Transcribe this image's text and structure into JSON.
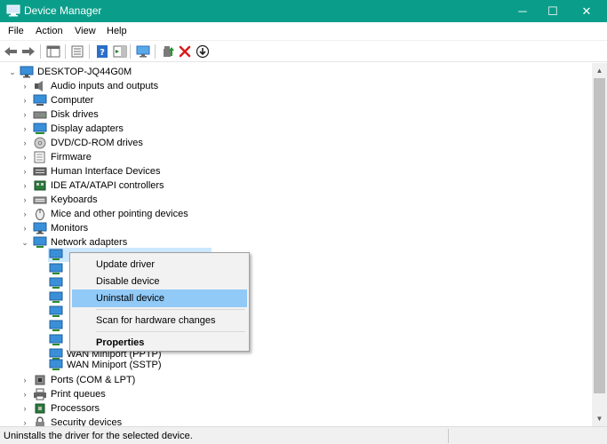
{
  "window": {
    "title": "Device Manager",
    "min_glyph": "─",
    "max_glyph": "☐",
    "close_glyph": "✕",
    "accent": "#0a9e8a"
  },
  "menu": [
    "File",
    "Action",
    "View",
    "Help"
  ],
  "tree": {
    "root": "DESKTOP-JQ44G0M",
    "categories": [
      {
        "label": "Audio inputs and outputs",
        "icon": "speaker-icon"
      },
      {
        "label": "Computer",
        "icon": "computer-icon"
      },
      {
        "label": "Disk drives",
        "icon": "disk-drive-icon"
      },
      {
        "label": "Display adapters",
        "icon": "display-adapter-icon"
      },
      {
        "label": "DVD/CD-ROM drives",
        "icon": "dvd-drive-icon"
      },
      {
        "label": "Firmware",
        "icon": "firmware-icon"
      },
      {
        "label": "Human Interface Devices",
        "icon": "hid-icon"
      },
      {
        "label": "IDE ATA/ATAPI controllers",
        "icon": "ide-controller-icon"
      },
      {
        "label": "Keyboards",
        "icon": "keyboard-icon"
      },
      {
        "label": "Mice and other pointing devices",
        "icon": "mouse-icon"
      },
      {
        "label": "Monitors",
        "icon": "monitor-icon"
      },
      {
        "label": "Network adapters",
        "icon": "network-adapter-icon"
      }
    ],
    "network_children": [
      "WAN Miniport (PPTP)",
      "WAN Miniport (SSTP)"
    ],
    "after": [
      {
        "label": "Ports (COM & LPT)",
        "icon": "port-icon"
      },
      {
        "label": "Print queues",
        "icon": "printer-icon"
      },
      {
        "label": "Processors",
        "icon": "processor-icon"
      },
      {
        "label": "Security devices",
        "icon": "security-device-icon"
      }
    ]
  },
  "context_menu": {
    "items": [
      "Update driver",
      "Disable device",
      "Uninstall device",
      "Scan for hardware changes",
      "Properties"
    ],
    "highlighted": "Uninstall device"
  },
  "status": "Uninstalls the driver for the selected device."
}
